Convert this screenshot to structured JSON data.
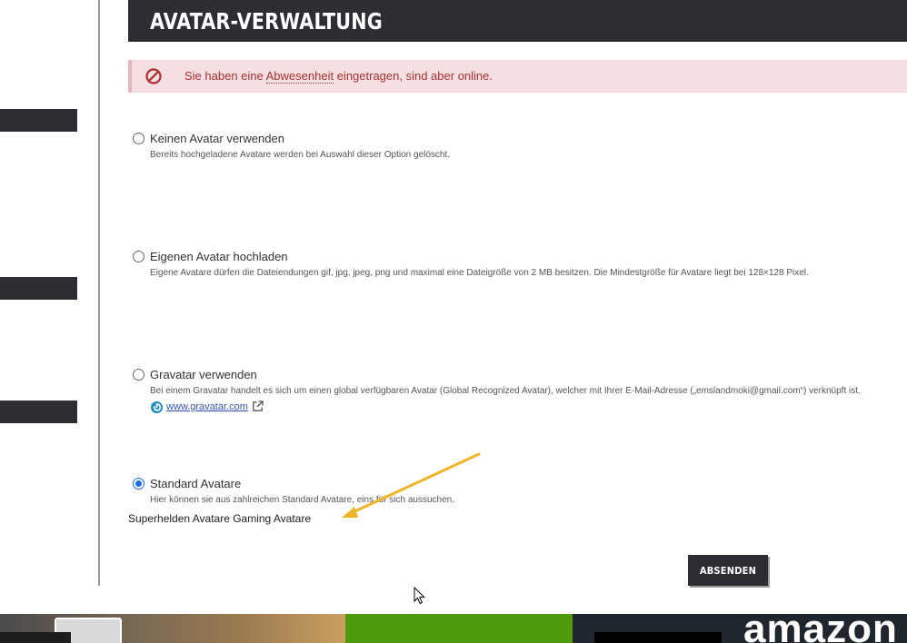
{
  "header": {
    "title": "AVATAR-VERWALTUNG"
  },
  "alert": {
    "prefix": "Sie haben eine ",
    "link": "Abwesenheit",
    "suffix": " eingetragen, sind aber online."
  },
  "options": [
    {
      "label": "Keinen Avatar verwenden",
      "description": "Bereits hochgeladene Avatare werden bei Auswahl dieser Option gelöscht.",
      "checked": false
    },
    {
      "label": "Eigenen Avatar hochladen",
      "description": "Eigene Avatare dürfen die Dateiendungen gif, jpg, jpeg, png und maximal eine Dateigröße von 2 MB besitzen. Die Mindestgröße für Avatare liegt bei 128×128 Pixel.",
      "checked": false
    },
    {
      "label": "Gravatar verwenden",
      "description": "Bei einem Gravatar handelt es sich um einen global verfügbaren Avatar (Global Recognized Avatar), welcher mit Ihrer E-Mail-Adresse („emslandmoki@gmail.com“) verknüpft ist.",
      "link": "www.gravatar.com",
      "checked": false
    },
    {
      "label": "Standard Avatare",
      "description": "Hier können sie aus zahlreichen Standard Avatare, eins für sich aussuchen.",
      "checked": true
    }
  ],
  "standard_categories": "Superhelden Avatare Gaming Avatare",
  "submit_label": "ABSENDEN",
  "banner": {
    "brand": "amazon"
  },
  "colors": {
    "header_bg": "#2c2e33",
    "alert_bg": "#f6dfe0",
    "alert_text": "#a43234",
    "radio_checked": "#1b6fe0",
    "annotation_arrow": "#f0b429"
  },
  "icons": {
    "alert": "prohibited-icon",
    "gravatar": "gravatar-icon",
    "external": "external-link-icon",
    "cursor": "mouse-cursor-icon"
  }
}
